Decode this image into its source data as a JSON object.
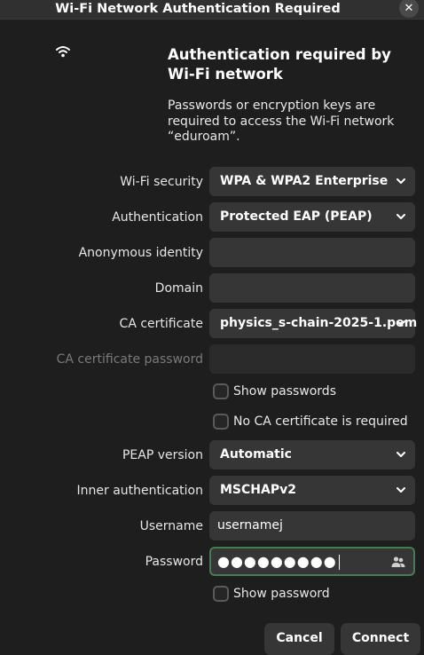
{
  "window": {
    "title": "Wi-Fi Network Authentication Required",
    "close_glyph": "✕"
  },
  "header": {
    "heading": "Authentication required by Wi-Fi network",
    "description": "Passwords or encryption keys are required to access the Wi-Fi network “eduroam”.",
    "icon": "wifi-icon"
  },
  "form": {
    "wifi_security": {
      "label": "Wi-Fi security",
      "value": "WPA & WPA2 Enterprise"
    },
    "authentication": {
      "label": "Authentication",
      "value": "Protected EAP (PEAP)"
    },
    "anonymous_identity": {
      "label": "Anonymous identity",
      "value": ""
    },
    "domain": {
      "label": "Domain",
      "value": ""
    },
    "ca_certificate": {
      "label": "CA certificate",
      "value": "physics_s-chain-2025-1.pem"
    },
    "ca_certificate_password": {
      "label": "CA certificate password",
      "value": ""
    },
    "show_passwords": {
      "label": "Show passwords",
      "checked": false
    },
    "no_ca_required": {
      "label": "No CA certificate is required",
      "checked": false
    },
    "peap_version": {
      "label": "PEAP version",
      "value": "Automatic"
    },
    "inner_authentication": {
      "label": "Inner authentication",
      "value": "MSCHAPv2"
    },
    "username": {
      "label": "Username",
      "value": "usernamej"
    },
    "password": {
      "label": "Password",
      "value": "●●●●●●●●●"
    },
    "show_password": {
      "label": "Show password",
      "checked": false
    }
  },
  "buttons": {
    "cancel": "Cancel",
    "connect": "Connect"
  },
  "colors": {
    "background": "#1e1e1e",
    "control": "#363636",
    "focus_border": "#4a7a55"
  }
}
